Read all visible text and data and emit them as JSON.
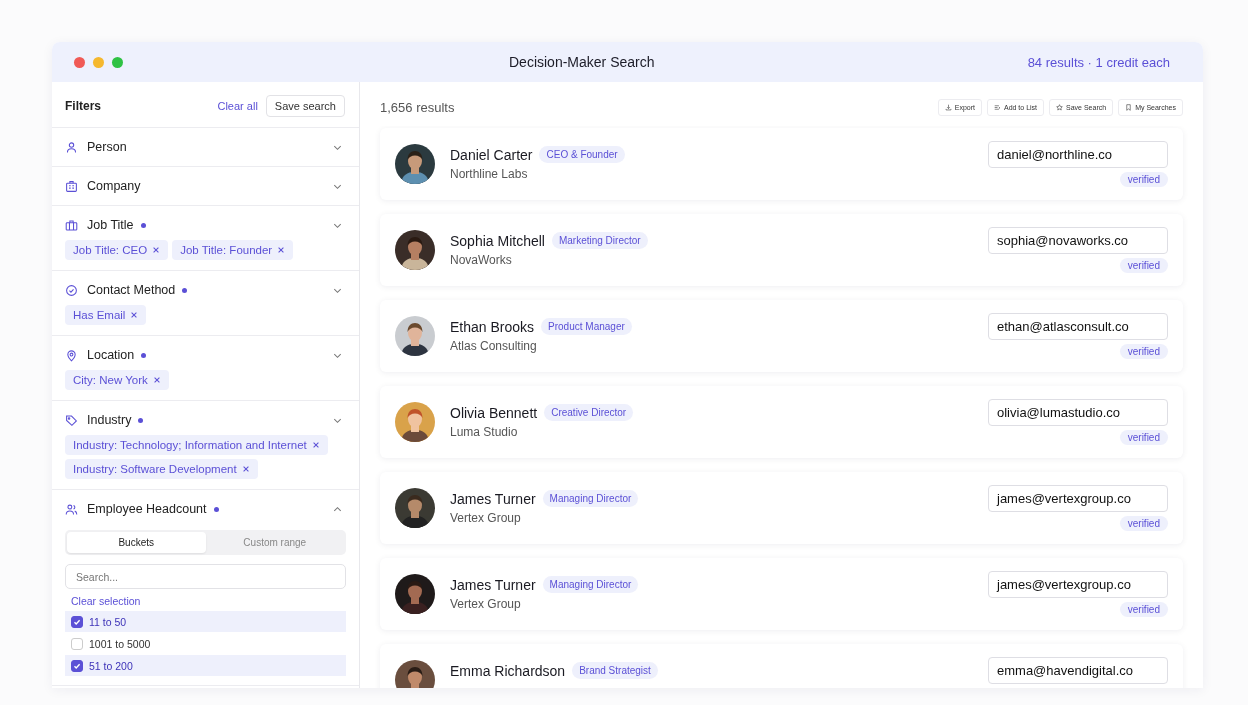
{
  "window": {
    "title": "Decision-Maker Search",
    "summary": "84 results · 1 credit each"
  },
  "filters": {
    "title": "Filters",
    "clear_all": "Clear all",
    "save_search": "Save search",
    "sections": [
      {
        "label": "Person",
        "active": false,
        "expanded": false
      },
      {
        "label": "Company",
        "active": false,
        "expanded": false
      },
      {
        "label": "Job Title",
        "active": true,
        "expanded": false,
        "chips": [
          "Job Title: CEO",
          "Job Title: Founder"
        ]
      },
      {
        "label": "Contact Method",
        "active": true,
        "expanded": false,
        "chips": [
          "Has Email"
        ]
      },
      {
        "label": "Location",
        "active": true,
        "expanded": false,
        "chips": [
          "City: New York"
        ]
      },
      {
        "label": "Industry",
        "active": true,
        "expanded": false,
        "chips": [
          "Industry: Technology; Information and Internet",
          "Industry: Software Development"
        ]
      },
      {
        "label": "Employee Headcount",
        "active": true,
        "expanded": true
      }
    ],
    "headcount": {
      "tabs": [
        {
          "label": "Buckets",
          "selected": true
        },
        {
          "label": "Custom range",
          "selected": false
        }
      ],
      "search": {
        "placeholder": "Search..."
      },
      "clear_selection": "Clear selection",
      "options": [
        {
          "label": "11 to 50",
          "checked": true
        },
        {
          "label": "1001 to 5000",
          "checked": false
        },
        {
          "label": "51 to 200",
          "checked": true
        }
      ]
    }
  },
  "results": {
    "count": "1,656 results",
    "actions": [
      "Export",
      "Add to List",
      "Save Search",
      "My Searches"
    ],
    "people": [
      {
        "name": "Daniel Carter",
        "title": "CEO & Founder",
        "company": "Northline Labs",
        "email": "daniel@northline.co",
        "status": "verified"
      },
      {
        "name": "Sophia Mitchell",
        "title": "Marketing Director",
        "company": "NovaWorks",
        "email": "sophia@novaworks.co",
        "status": "verified"
      },
      {
        "name": "Ethan Brooks",
        "title": "Product Manager",
        "company": "Atlas Consulting",
        "email": "ethan@atlasconsult.co",
        "status": "verified"
      },
      {
        "name": "Olivia Bennett",
        "title": "Creative Director",
        "company": "Luma Studio",
        "email": "olivia@lumastudio.co",
        "status": "verified"
      },
      {
        "name": "James Turner",
        "title": "Managing Director",
        "company": "Vertex Group",
        "email": "james@vertexgroup.co",
        "status": "verified"
      },
      {
        "name": "James Turner",
        "title": "Managing Director",
        "company": "Vertex Group",
        "email": "james@vertexgroup.co",
        "status": "verified"
      },
      {
        "name": "Emma Richardson",
        "title": "Brand Strategist",
        "email": "emma@havendigital.co"
      }
    ]
  }
}
